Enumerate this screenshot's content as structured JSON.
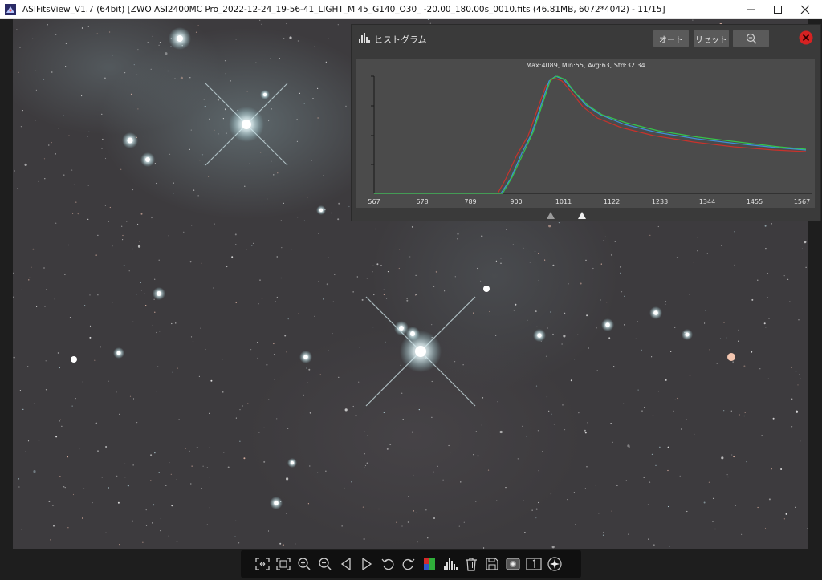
{
  "window": {
    "title": "ASIFitsView_V1.7 (64bit) [ZWO ASI2400MC Pro_2022-12-24_19-56-41_LIGHT_M 45_G140_O30_ -20.00_180.00s_0010.fits (46.81MB, 6072*4042) - 11/15]",
    "minimize_icon": "minimize-icon",
    "maximize_icon": "maximize-icon",
    "close_icon": "close-icon"
  },
  "histogram": {
    "title": "ヒストグラム",
    "auto_label": "オート",
    "reset_label": "リセット",
    "zoom_out_icon": "zoom-out-icon",
    "close_icon": "close-circle-icon",
    "stats": "Max:4089, Min:55, Avg:63, Std:32.34",
    "ticks": [
      "567",
      "678",
      "789",
      "900",
      "1011",
      "1122",
      "1233",
      "1344",
      "1455",
      "1567"
    ],
    "colors": {
      "red": "#c8322c",
      "green": "#35c44a",
      "blue": "#3f8fd8"
    }
  },
  "toolbar": {
    "icons": [
      "fit-window-icon",
      "actual-size-icon",
      "zoom-in-icon",
      "zoom-out-icon",
      "previous-icon",
      "next-icon",
      "rotate-left-icon",
      "rotate-right-icon",
      "color-channels-icon",
      "histogram-icon",
      "delete-icon",
      "save-icon",
      "stretch-icon",
      "one-to-one-icon",
      "star-icon"
    ]
  }
}
